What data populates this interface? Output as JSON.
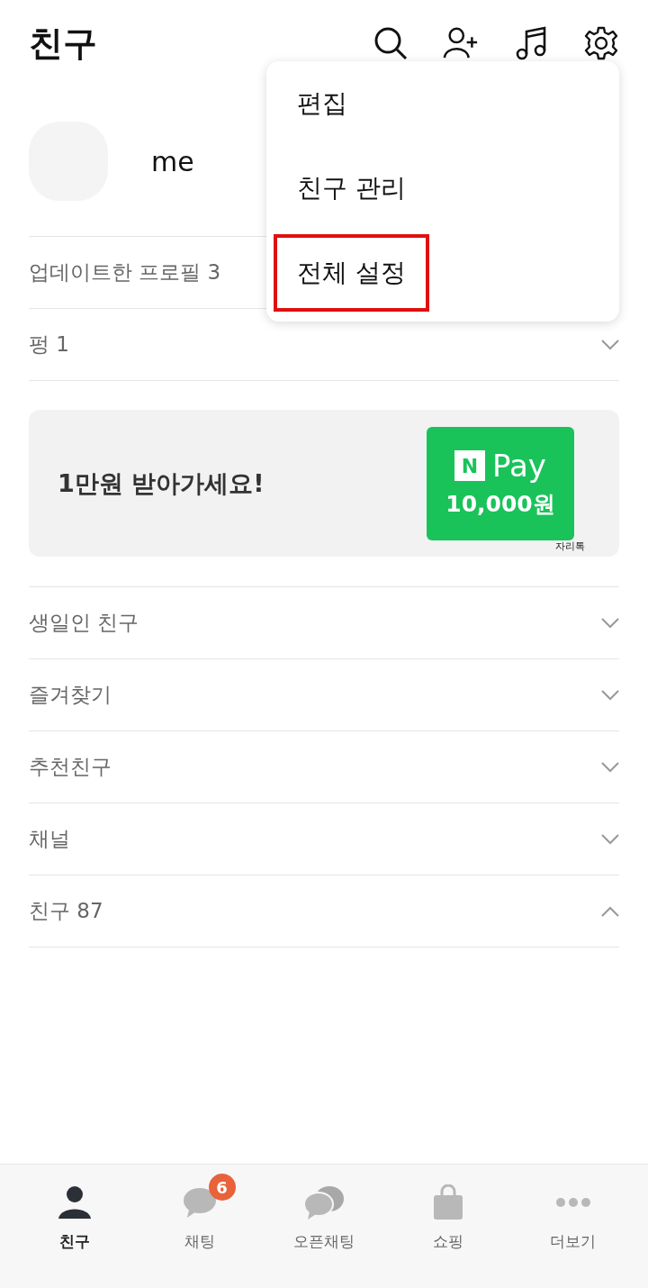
{
  "header": {
    "title": "친구"
  },
  "profile": {
    "name": "me"
  },
  "sections_top": [
    {
      "label": "업데이트한 프로필 3"
    },
    {
      "label": "펑 1",
      "expanded": false
    }
  ],
  "banner": {
    "text": "1만원 받아가세요!",
    "pay_label": "Pay",
    "pay_letter": "N",
    "amount": "10,000원",
    "sponsor": "자리톡"
  },
  "sections": [
    {
      "label": "생일인 친구",
      "expanded": false
    },
    {
      "label": "즐겨찾기",
      "expanded": false
    },
    {
      "label": "추천친구",
      "expanded": false
    },
    {
      "label": "채널",
      "expanded": false
    },
    {
      "label": "친구 87",
      "expanded": true
    }
  ],
  "menu": [
    {
      "label": "편집",
      "highlighted": false
    },
    {
      "label": "친구 관리",
      "highlighted": false
    },
    {
      "label": "전체 설정",
      "highlighted": true
    }
  ],
  "tabs": [
    {
      "label": "친구",
      "selected": true,
      "kind": "person"
    },
    {
      "label": "채팅",
      "selected": false,
      "kind": "chat",
      "badge": "6"
    },
    {
      "label": "오픈채팅",
      "selected": false,
      "kind": "openchat"
    },
    {
      "label": "쇼핑",
      "selected": false,
      "kind": "shop"
    },
    {
      "label": "더보기",
      "selected": false,
      "kind": "more"
    }
  ]
}
